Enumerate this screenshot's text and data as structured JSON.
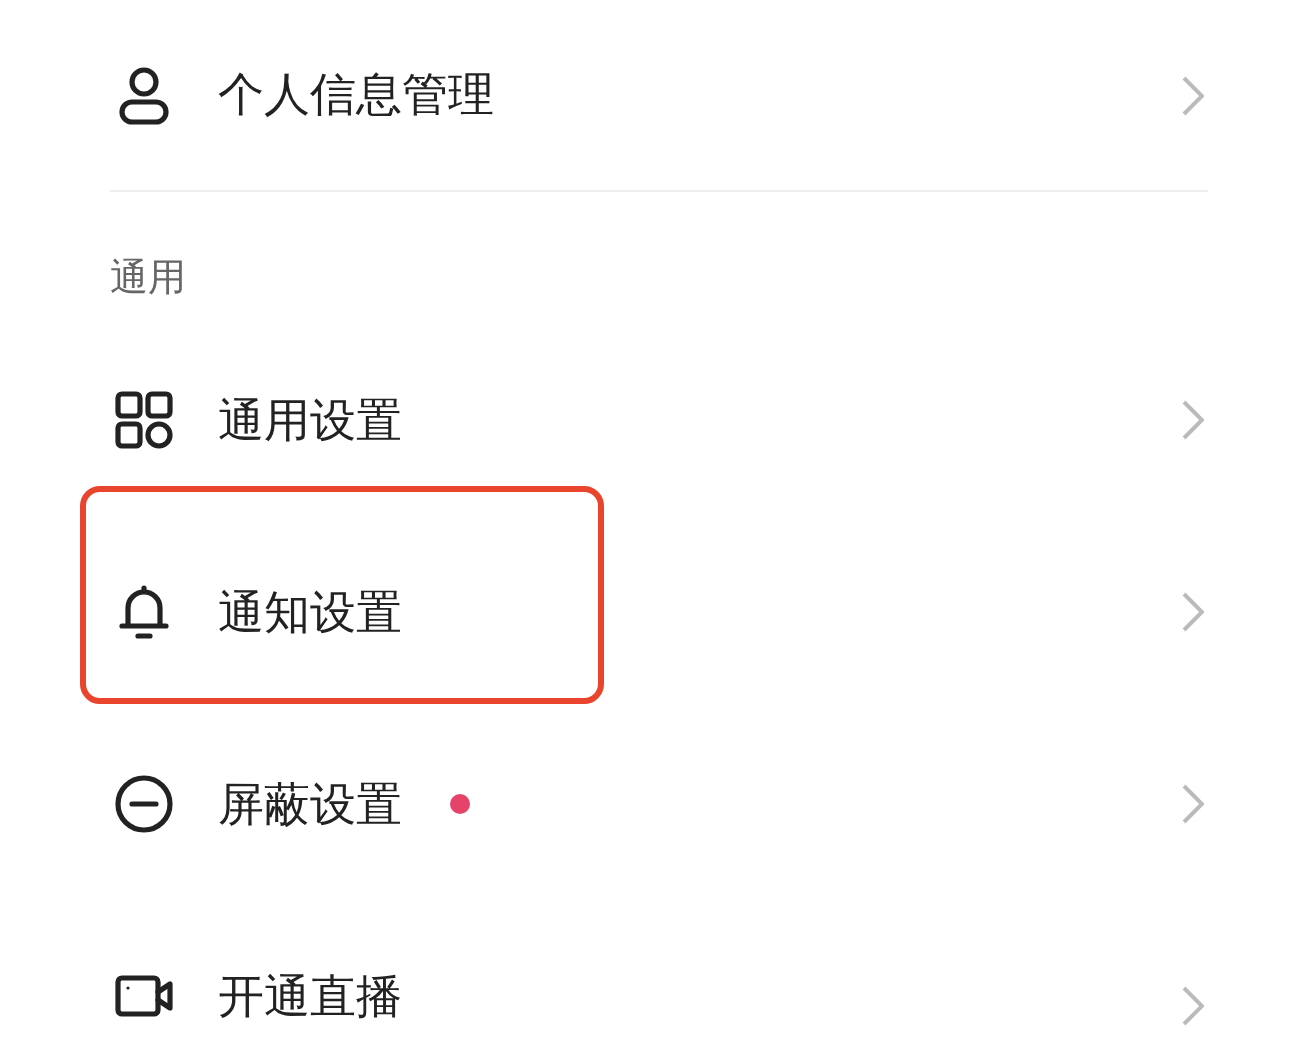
{
  "sections": [
    {
      "items": [
        {
          "kind": "person",
          "label": "个人信息管理",
          "highlighted": false,
          "badge": false
        }
      ]
    },
    {
      "title": "通用",
      "items": [
        {
          "kind": "grid",
          "label": "通用设置",
          "highlighted": false,
          "badge": false
        },
        {
          "kind": "bell",
          "label": "通知设置",
          "highlighted": true,
          "badge": false
        },
        {
          "kind": "block",
          "label": "屏蔽设置",
          "highlighted": false,
          "badge": true
        },
        {
          "kind": "camera",
          "label": "开通直播",
          "highlighted": false,
          "badge": false
        }
      ]
    }
  ]
}
